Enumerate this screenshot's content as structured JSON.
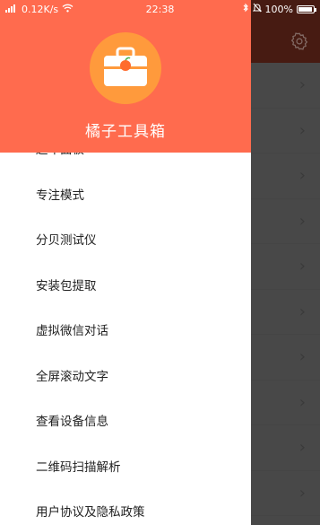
{
  "status_bar": {
    "speed": "0.12K/s",
    "time": "22:38",
    "battery": "100%",
    "battery_level": 1.0
  },
  "drawer": {
    "title": "橘子工具箱",
    "items": [
      {
        "label": "超车面板"
      },
      {
        "label": "专注模式"
      },
      {
        "label": "分贝测试仪"
      },
      {
        "label": "安装包提取"
      },
      {
        "label": "虚拟微信对话"
      },
      {
        "label": "全屏滚动文字"
      },
      {
        "label": "查看设备信息"
      },
      {
        "label": "二维码扫描解析"
      },
      {
        "label": "用户协议及隐私政策"
      }
    ]
  },
  "icons": {
    "logo": "toolbox-icon",
    "settings": "gear-icon",
    "row_arrow": "chevron-right-icon"
  },
  "colors": {
    "drawer_header": "#ff6b4e",
    "logo_circle": "#ff9a3c",
    "app_header": "#6e2a1d"
  }
}
